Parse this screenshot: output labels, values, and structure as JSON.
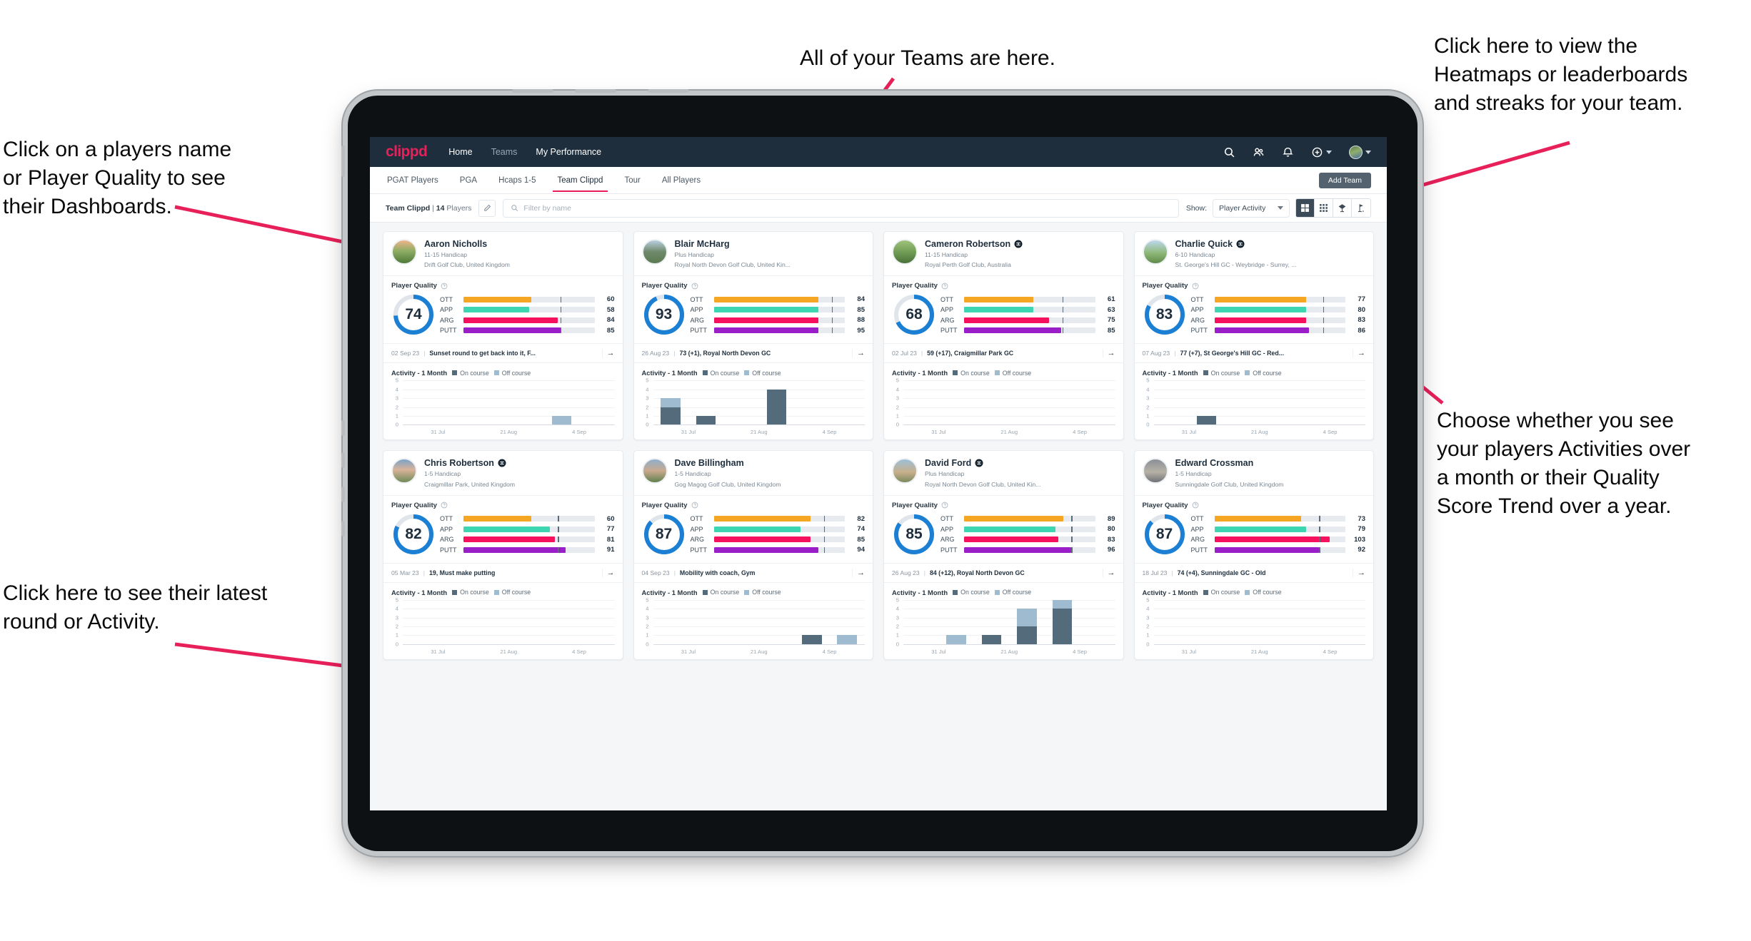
{
  "annotations": [
    {
      "id": "a-teams",
      "text": "All of your Teams are here."
    },
    {
      "id": "a-heatmaps",
      "text": "Click here to view the\nHeatmaps or leaderboards\nand streaks for your team."
    },
    {
      "id": "a-names",
      "text": "Click on a players name\nor Player Quality to see\ntheir Dashboards."
    },
    {
      "id": "a-show",
      "text": "Choose whether you see\nyour players Activities over\na month or their Quality\nScore Trend over a year."
    },
    {
      "id": "a-latest",
      "text": "Click here to see their latest\nround or Activity."
    }
  ],
  "app": {
    "brand": "clippd",
    "nav_links": [
      {
        "label": "Home",
        "active": true
      },
      {
        "label": "Teams",
        "active": false
      },
      {
        "label": "My Performance",
        "active": true
      }
    ],
    "nav_icons": [
      "search-icon",
      "people-icon",
      "bell-icon",
      "plus-circle-icon",
      "avatar"
    ],
    "tabs": [
      {
        "label": "PGAT Players",
        "active": false
      },
      {
        "label": "PGA",
        "active": false
      },
      {
        "label": "Hcaps 1-5",
        "active": false
      },
      {
        "label": "Team Clippd",
        "active": true
      },
      {
        "label": "Tour",
        "active": false
      },
      {
        "label": "All Players",
        "active": false
      }
    ],
    "add_team_label": "Add Team",
    "team_name": "Team Clippd",
    "team_count": "14",
    "team_count_suffix": " Players",
    "team_separator": " | ",
    "search_placeholder": "Filter by name",
    "show_label": "Show:",
    "show_value": "Player Activity",
    "view_buttons": [
      {
        "icon": "grid-large-icon",
        "active": true
      },
      {
        "icon": "grid-small-icon",
        "active": false
      },
      {
        "icon": "trophy-icon",
        "active": false
      },
      {
        "icon": "golf-flag-icon",
        "active": false
      }
    ],
    "player_quality_label": "Player Quality",
    "activity_label": "Activity - 1 Month",
    "legend_on": "On course",
    "legend_off": "Off course",
    "xticks": [
      "31 Jul",
      "21 Aug",
      "4 Sep"
    ],
    "yticks": [
      "5",
      "4",
      "3",
      "2",
      "1",
      "0"
    ]
  },
  "colors": {
    "brand_pink": "#e8205a",
    "nav_bg": "#1e2e3d",
    "ring": "#1b7fd4",
    "ott": "#f5a623",
    "app": "#3ed6b0",
    "arg": "#f5115e",
    "putt": "#9b1fc9",
    "on_course": "#546b7c",
    "off_course": "#9fbbd0"
  },
  "players": [
    {
      "name": "Aaron Nicholls",
      "verified": false,
      "handicap": "11-15 Handicap",
      "club": "Drift Golf Club, United Kingdom",
      "quality": 74,
      "metrics": [
        {
          "key": "OTT",
          "value": 60,
          "fill": 52,
          "tick": 74
        },
        {
          "key": "APP",
          "value": 58,
          "fill": 50,
          "tick": 74
        },
        {
          "key": "ARG",
          "value": 84,
          "fill": 72,
          "tick": 74
        },
        {
          "key": "PUTT",
          "value": 85,
          "fill": 74,
          "tick": 74
        }
      ],
      "round_date": "02 Sep 23",
      "round_text": "Sunset round to get back into it, F...",
      "activity": [
        {
          "on": 0,
          "off": 0
        },
        {
          "on": 0,
          "off": 0
        },
        {
          "on": 0,
          "off": 0
        },
        {
          "on": 0,
          "off": 0
        },
        {
          "on": 0,
          "off": 1
        },
        {
          "on": 0,
          "off": 0
        }
      ]
    },
    {
      "name": "Blair McHarg",
      "verified": false,
      "handicap": "Plus Handicap",
      "club": "Royal North Devon Golf Club, United Kin...",
      "quality": 93,
      "metrics": [
        {
          "key": "OTT",
          "value": 84,
          "fill": 80,
          "tick": 90
        },
        {
          "key": "APP",
          "value": 85,
          "fill": 80,
          "tick": 90
        },
        {
          "key": "ARG",
          "value": 88,
          "fill": 80,
          "tick": 90
        },
        {
          "key": "PUTT",
          "value": 95,
          "fill": 80,
          "tick": 90
        }
      ],
      "round_date": "26 Aug 23",
      "round_text": "73 (+1), Royal North Devon GC",
      "activity": [
        {
          "on": 2,
          "off": 1
        },
        {
          "on": 1,
          "off": 0
        },
        {
          "on": 0,
          "off": 0
        },
        {
          "on": 4,
          "off": 0
        },
        {
          "on": 0,
          "off": 0
        },
        {
          "on": 0,
          "off": 0
        }
      ]
    },
    {
      "name": "Cameron Robertson",
      "verified": true,
      "handicap": "11-15 Handicap",
      "club": "Royal Perth Golf Club, Australia",
      "quality": 68,
      "metrics": [
        {
          "key": "OTT",
          "value": 61,
          "fill": 53,
          "tick": 75
        },
        {
          "key": "APP",
          "value": 63,
          "fill": 53,
          "tick": 75
        },
        {
          "key": "ARG",
          "value": 75,
          "fill": 65,
          "tick": 75
        },
        {
          "key": "PUTT",
          "value": 85,
          "fill": 74,
          "tick": 75
        }
      ],
      "round_date": "02 Jul 23",
      "round_text": "59 (+17), Craigmillar Park GC",
      "activity": [
        {
          "on": 0,
          "off": 0
        },
        {
          "on": 0,
          "off": 0
        },
        {
          "on": 0,
          "off": 0
        },
        {
          "on": 0,
          "off": 0
        },
        {
          "on": 0,
          "off": 0
        },
        {
          "on": 0,
          "off": 0
        }
      ]
    },
    {
      "name": "Charlie Quick",
      "verified": true,
      "handicap": "6-10 Handicap",
      "club": "St. George's Hill GC - Weybridge - Surrey, ...",
      "quality": 83,
      "metrics": [
        {
          "key": "OTT",
          "value": 77,
          "fill": 70,
          "tick": 83
        },
        {
          "key": "APP",
          "value": 80,
          "fill": 70,
          "tick": 83
        },
        {
          "key": "ARG",
          "value": 83,
          "fill": 70,
          "tick": 83
        },
        {
          "key": "PUTT",
          "value": 86,
          "fill": 72,
          "tick": 83
        }
      ],
      "round_date": "07 Aug 23",
      "round_text": "77 (+7), St George's Hill GC - Red...",
      "activity": [
        {
          "on": 0,
          "off": 0
        },
        {
          "on": 1,
          "off": 0
        },
        {
          "on": 0,
          "off": 0
        },
        {
          "on": 0,
          "off": 0
        },
        {
          "on": 0,
          "off": 0
        },
        {
          "on": 0,
          "off": 0
        }
      ]
    },
    {
      "name": "Chris Robertson",
      "verified": true,
      "handicap": "1-5 Handicap",
      "club": "Craigmillar Park, United Kingdom",
      "quality": 82,
      "metrics": [
        {
          "key": "OTT",
          "value": 60,
          "fill": 52,
          "tick": 72
        },
        {
          "key": "APP",
          "value": 77,
          "fill": 66,
          "tick": 72
        },
        {
          "key": "ARG",
          "value": 81,
          "fill": 70,
          "tick": 72
        },
        {
          "key": "PUTT",
          "value": 91,
          "fill": 78,
          "tick": 72
        }
      ],
      "round_date": "05 Mar 23",
      "round_text": "19, Must make putting",
      "activity": [
        {
          "on": 0,
          "off": 0
        },
        {
          "on": 0,
          "off": 0
        },
        {
          "on": 0,
          "off": 0
        },
        {
          "on": 0,
          "off": 0
        },
        {
          "on": 0,
          "off": 0
        },
        {
          "on": 0,
          "off": 0
        }
      ]
    },
    {
      "name": "Dave Billingham",
      "verified": false,
      "handicap": "1-5 Handicap",
      "club": "Gog Magog Golf Club, United Kingdom",
      "quality": 87,
      "metrics": [
        {
          "key": "OTT",
          "value": 82,
          "fill": 74,
          "tick": 84
        },
        {
          "key": "APP",
          "value": 74,
          "fill": 66,
          "tick": 84
        },
        {
          "key": "ARG",
          "value": 85,
          "fill": 74,
          "tick": 84
        },
        {
          "key": "PUTT",
          "value": 94,
          "fill": 80,
          "tick": 84
        }
      ],
      "round_date": "04 Sep 23",
      "round_text": "Mobility with coach, Gym",
      "activity": [
        {
          "on": 0,
          "off": 0
        },
        {
          "on": 0,
          "off": 0
        },
        {
          "on": 0,
          "off": 0
        },
        {
          "on": 0,
          "off": 0
        },
        {
          "on": 1,
          "off": 0
        },
        {
          "on": 0,
          "off": 1
        }
      ]
    },
    {
      "name": "David Ford",
      "verified": true,
      "handicap": "Plus Handicap",
      "club": "Royal North Devon Golf Club, United Kin...",
      "quality": 85,
      "metrics": [
        {
          "key": "OTT",
          "value": 89,
          "fill": 76,
          "tick": 82
        },
        {
          "key": "APP",
          "value": 80,
          "fill": 70,
          "tick": 82
        },
        {
          "key": "ARG",
          "value": 83,
          "fill": 72,
          "tick": 82
        },
        {
          "key": "PUTT",
          "value": 96,
          "fill": 82,
          "tick": 82
        }
      ],
      "round_date": "26 Aug 23",
      "round_text": "84 (+12), Royal North Devon GC",
      "activity": [
        {
          "on": 0,
          "off": 0
        },
        {
          "on": 0,
          "off": 1
        },
        {
          "on": 1,
          "off": 0
        },
        {
          "on": 2,
          "off": 2
        },
        {
          "on": 4,
          "off": 1
        },
        {
          "on": 0,
          "off": 0
        }
      ]
    },
    {
      "name": "Edward Crossman",
      "verified": false,
      "handicap": "1-5 Handicap",
      "club": "Sunningdale Golf Club, United Kingdom",
      "quality": 87,
      "metrics": [
        {
          "key": "OTT",
          "value": 73,
          "fill": 66,
          "tick": 80
        },
        {
          "key": "APP",
          "value": 79,
          "fill": 70,
          "tick": 80
        },
        {
          "key": "ARG",
          "value": 103,
          "fill": 88,
          "tick": 80
        },
        {
          "key": "PUTT",
          "value": 92,
          "fill": 80,
          "tick": 80
        }
      ],
      "round_date": "18 Jul 23",
      "round_text": "74 (+4), Sunningdale GC - Old",
      "activity": [
        {
          "on": 0,
          "off": 0
        },
        {
          "on": 0,
          "off": 0
        },
        {
          "on": 0,
          "off": 0
        },
        {
          "on": 0,
          "off": 0
        },
        {
          "on": 0,
          "off": 0
        },
        {
          "on": 0,
          "off": 0
        }
      ]
    }
  ]
}
